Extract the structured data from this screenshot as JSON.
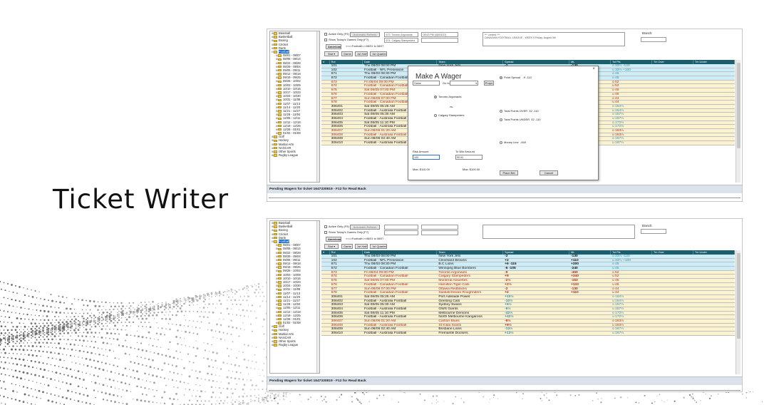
{
  "heading": "Ticket Writer",
  "sidebar": {
    "items": [
      {
        "label": "Baseball",
        "level": 0,
        "state": "+"
      },
      {
        "label": "Basketball",
        "level": 0,
        "state": "+"
      },
      {
        "label": "Boxing",
        "level": 0,
        "state": "+"
      },
      {
        "label": "Cricket",
        "level": 0,
        "state": "+"
      },
      {
        "label": "Darts",
        "level": 0,
        "state": "+"
      },
      {
        "label": "Football",
        "level": 0,
        "state": "-"
      },
      {
        "label": "08/01 - 08/07",
        "level": 1,
        "state": "+"
      },
      {
        "label": "08/08 - 08/14",
        "level": 1,
        "state": "+"
      },
      {
        "label": "08/22 - 08/28",
        "level": 1,
        "state": "+"
      },
      {
        "label": "08/29 - 09/04",
        "level": 1,
        "state": "+"
      },
      {
        "label": "09/05 - 09/11",
        "level": 1,
        "state": "+"
      },
      {
        "label": "09/12 - 09/18",
        "level": 1,
        "state": "+"
      },
      {
        "label": "09/19 - 09/25",
        "level": 1,
        "state": "+"
      },
      {
        "label": "09/26 - 10/02",
        "level": 1,
        "state": "+"
      },
      {
        "label": "10/03 - 10/09",
        "level": 1,
        "state": "+"
      },
      {
        "label": "10/10 - 10/16",
        "level": 1,
        "state": "+"
      },
      {
        "label": "10/17 - 10/23",
        "level": 1,
        "state": "+"
      },
      {
        "label": "10/24 - 10/30",
        "level": 1,
        "state": "+"
      },
      {
        "label": "10/31 - 11/06",
        "level": 1,
        "state": "+"
      },
      {
        "label": "11/07 - 11/13",
        "level": 1,
        "state": "+"
      },
      {
        "label": "11/14 - 11/20",
        "level": 1,
        "state": "+"
      },
      {
        "label": "11/21 - 11/27",
        "level": 1,
        "state": "+"
      },
      {
        "label": "11/28 - 12/04",
        "level": 1,
        "state": "+"
      },
      {
        "label": "12/05 - 12/11",
        "level": 1,
        "state": "+"
      },
      {
        "label": "12/12 - 12/18",
        "level": 1,
        "state": "+"
      },
      {
        "label": "12/19 - 12/25",
        "level": 1,
        "state": "+"
      },
      {
        "label": "12/26 - 01/01",
        "level": 1,
        "state": "+"
      },
      {
        "label": "01/02 - 01/08",
        "level": 1,
        "state": "+"
      },
      {
        "label": "Golf",
        "level": 0,
        "state": "+"
      },
      {
        "label": "Hockey",
        "level": 0,
        "state": "+"
      },
      {
        "label": "Martial Arts",
        "level": 0,
        "state": "+"
      },
      {
        "label": "NASCAR",
        "level": 0,
        "state": "+"
      },
      {
        "label": "Other Sports",
        "level": 0,
        "state": "+"
      },
      {
        "label": "Rugby League",
        "level": 0,
        "state": "+"
      }
    ]
  },
  "controls": {
    "active_only": "Active Only (F9)",
    "show_today": "Show Today's Games Only (F7)",
    "auto_refresh": "Automatic Refresh",
    "american": "American",
    "breadcrumb": "<<<>Football<>>08/01 to 08/07",
    "periods": [
      "Game",
      "1st Half",
      "1st Quarter"
    ],
    "stat_label": "Stat",
    "branch_label": "Branch:",
    "team1": "673. Toronto Argonauts",
    "team2": "674. Calgary Stampeders",
    "game_time": "08:00 PM (08/04/22)",
    "info_text": "*** Limited ***",
    "info_text2": "CANADIAN FOOTBALL LEAGUE - WEEK 9 Friday, August 4th"
  },
  "grid": {
    "headers": [
      "#",
      "Rot",
      "Date",
      "Team",
      "Spread",
      "ML",
      "Tot Pts",
      "Tm Over",
      "Tm Under"
    ],
    "rows": [
      {
        "rot": "101",
        "date": "Thu 08/03 08:00 PM",
        "team": "New York Jets",
        "spread": "-2",
        "ml": "-130",
        "tot": "o 33½ -120",
        "tone": "blue"
      },
      {
        "rot": "102",
        "date": "Football - NFL Preseason",
        "team": "Cleveland Browns",
        "spread": "+2",
        "ml": "+110",
        "tot": "u 33½ +100",
        "tone": "blue"
      },
      {
        "rot": "671",
        "date": "Thu 08/03 08:30 PM",
        "team": "B.C Lions",
        "spread": "+6 -115",
        "ml": "+200",
        "tot": "o 45",
        "tone": "blue"
      },
      {
        "rot": "672",
        "date": "Football - Canadian Football",
        "team": "Winnipeg Blue Bombers",
        "spread": "-6 -105",
        "ml": "-240",
        "tot": "u 45",
        "tone": "blue"
      },
      {
        "rot": "673",
        "date": "Fri 08/04 09:00 PM",
        "team": "Toronto Argonauts",
        "spread": "-9",
        "ml": "-450",
        "tot": "o 52",
        "tone": "red"
      },
      {
        "rot": "674",
        "date": "Football - Canadian Football",
        "team": "Calgary Stampeders",
        "spread": "+9",
        "ml": "+340",
        "tot": "u 52",
        "tone": "red"
      },
      {
        "rot": "675",
        "date": "Sat 08/05 07:00 PM",
        "team": "Montreal Alouettes",
        "spread": "-2½",
        "ml": "-153",
        "tot": "o 45",
        "tone": "red"
      },
      {
        "rot": "676",
        "date": "Football - Canadian Football",
        "team": "Hamilton Tiger-Cats",
        "spread": "+2½",
        "ml": "+133",
        "tot": "u 45",
        "tone": "red"
      },
      {
        "rot": "677",
        "date": "Sun 08/06 07:00 PM",
        "team": "Ottawa Redblacks",
        "spread": "-2",
        "ml": "-130",
        "tot": "o 44",
        "tone": "red"
      },
      {
        "rot": "678",
        "date": "Football - Canadian Football",
        "team": "Saskatchewan Roughriders",
        "spread": "+2",
        "ml": "+110",
        "tot": "u 44",
        "tone": "red"
      },
      {
        "rot": "306401",
        "date": "Sat 08/05 05:25 AM",
        "team": "Port Adelaide Power",
        "spread": "+10½",
        "ml": "",
        "tot": "o 164½",
        "tone": "yellow"
      },
      {
        "rot": "306402",
        "date": "Football - Australia Football",
        "team": "Geelong Cats",
        "spread": "-10½",
        "ml": "",
        "tot": "u 164½",
        "tone": "yellow"
      },
      {
        "rot": "306403",
        "date": "Sat 08/05 05:30 AM",
        "team": "Sydney Swans",
        "spread": "+6½",
        "ml": "",
        "tot": "o 157½",
        "tone": "yellow"
      },
      {
        "rot": "306404",
        "date": "Football - Australia Football",
        "team": "GWS Giants",
        "spread": "-6½",
        "ml": "",
        "tot": "u 157½",
        "tone": "yellow"
      },
      {
        "rot": "306405",
        "date": "Sat 08/05 11:10 PM",
        "team": "Melbourne Demons",
        "spread": "-42½",
        "ml": "",
        "tot": "o 172½",
        "tone": "yellow"
      },
      {
        "rot": "306406",
        "date": "Football - Australia Football",
        "team": "North Melbourne Kangaroos",
        "spread": "+42½",
        "ml": "",
        "tot": "u 172½",
        "tone": "yellow"
      },
      {
        "rot": "306407",
        "date": "Sun 08/06 01:20 AM",
        "team": "Carlton Blues",
        "spread": "-9½",
        "ml": "",
        "tot": "o 163½",
        "tone": "red"
      },
      {
        "rot": "306408",
        "date": "Football - Australia Football",
        "team": "St Kilda Saints",
        "spread": "+9½",
        "ml": "",
        "tot": "u 163½",
        "tone": "red"
      },
      {
        "rot": "306409",
        "date": "Sun 08/06 02:40 AM",
        "team": "Brisbane Lions",
        "spread": "-13½",
        "ml": "",
        "tot": "o 167½",
        "tone": "yellow"
      },
      {
        "rot": "306410",
        "date": "Football - Australia Football",
        "team": "Fremantle Dockers",
        "spread": "+13½",
        "ml": "",
        "tot": "u 167½",
        "tone": "yellow"
      }
    ]
  },
  "wager": {
    "title": "Make A Wager",
    "close": "×",
    "game_placeholder": "Game",
    "goto": "Go to",
    "props": "Props",
    "team1": "Toronto Argonauts",
    "vs": "vs.",
    "team2": "Calgary Stampeders",
    "point_spread": "Point Spread",
    "spread_val": "-9 -110",
    "total_over": "Total Points OVER",
    "over_val": "52 -110",
    "total_under": "Total Points UNDER",
    "under_val": "52 -110",
    "money_line": "Money Line",
    "ml_val": "-450",
    "risk_label": "Risk Amount",
    "win_label": "To Win Amount",
    "risk_val": "100",
    "win_val": "90.91",
    "max1": "Max: $110.00",
    "max2": "Max: $100.00",
    "place_bet": "Place Bet",
    "cancel": "Cancel"
  },
  "pending": "Pending Wagers for ticket 1647330819 - F12 for Read Back"
}
